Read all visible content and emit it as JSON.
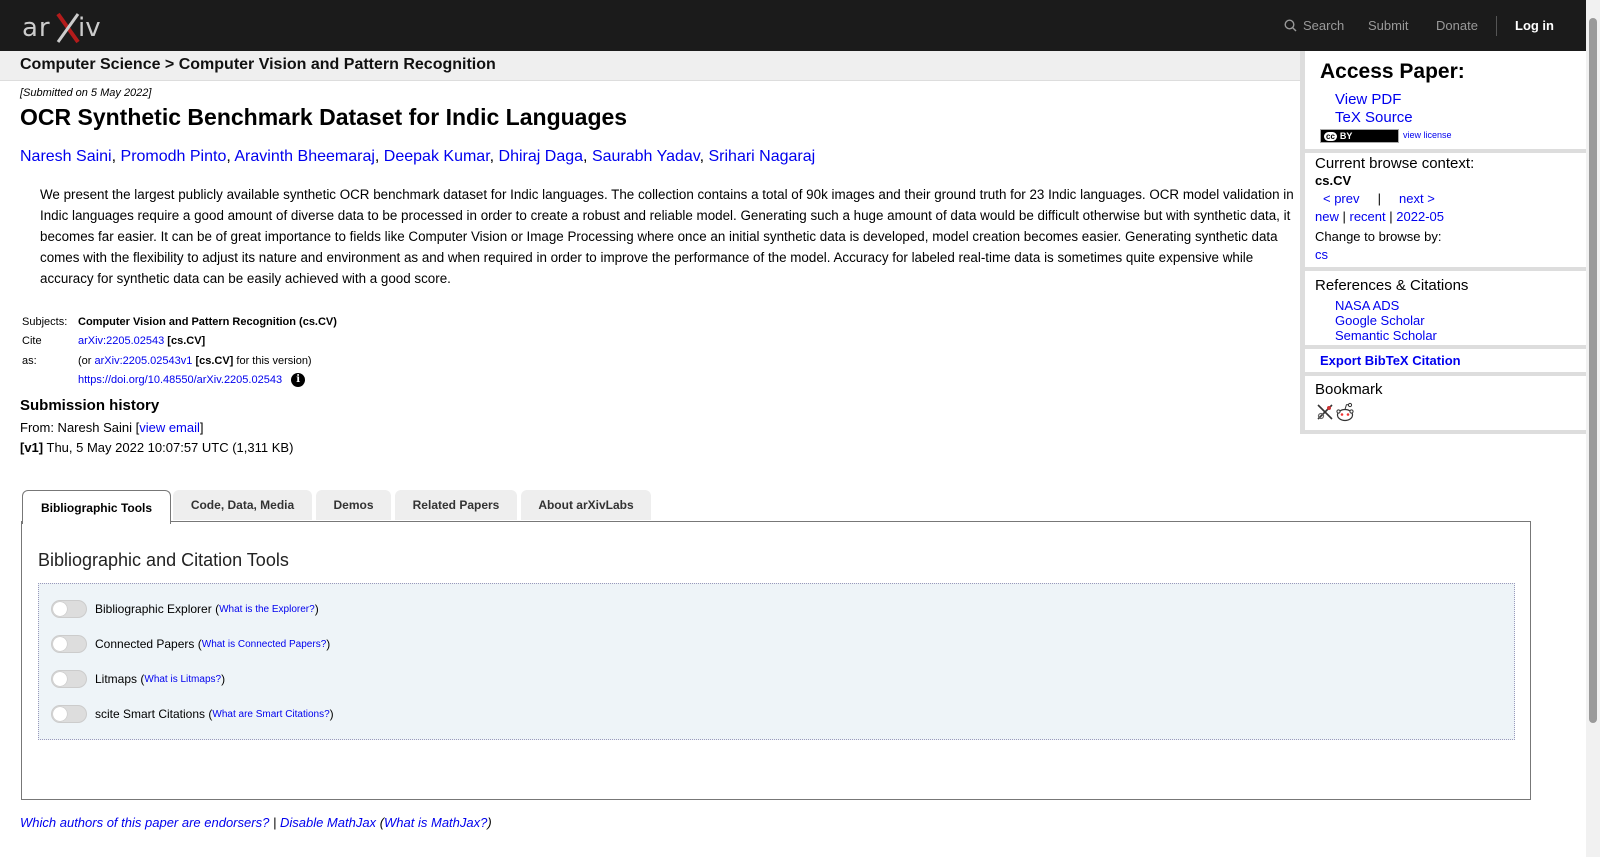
{
  "header": {
    "logo_text": "arXiv",
    "nav": {
      "search": "Search",
      "submit": "Submit",
      "donate": "Donate",
      "login": "Log in"
    }
  },
  "breadcrumb": "Computer Science > Computer Vision and Pattern Recognition",
  "paper": {
    "submitted": "[Submitted on 5 May 2022]",
    "title": "OCR Synthetic Benchmark Dataset for Indic Languages",
    "authors": [
      "Naresh Saini",
      "Promodh Pinto",
      "Aravinth Bheemaraj",
      "Deepak Kumar",
      "Dhiraj Daga",
      "Saurabh Yadav",
      "Srihari Nagaraj"
    ],
    "author_separator": ",",
    "abstract": "We present the largest publicly available synthetic OCR benchmark dataset for Indic languages. The collection contains a total of 90k images and their ground truth for 23 Indic languages. OCR model validation in Indic languages require a good amount of diverse data to be processed in order to create a robust and reliable model. Generating such a huge amount of data would be difficult otherwise but with synthetic data, it becomes far easier. It can be of great importance to fields like Computer Vision or Image Processing where once an initial synthetic data is developed, model creation becomes easier. Generating synthetic data comes with the flexibility to adjust its nature and environment as and when required in order to improve the performance of the model. Accuracy for labeled real-time data is sometimes quite expensive while accuracy for synthetic data can be easily achieved with a good score.",
    "subjects_label": "Subjects:",
    "subjects_value": "Computer Vision and Pattern Recognition (cs.CV)",
    "cite_label": "Cite as:",
    "cite_id": "arXiv:2205.02543",
    "cite_cat": "[cs.CV]",
    "cite_or_prefix": "(or",
    "cite_version_id": "arXiv:2205.02543v1",
    "cite_version_cat": "[cs.CV]",
    "cite_version_suffix": "for this version)",
    "doi": "https://doi.org/10.48550/arXiv.2205.02543",
    "info_glyph": "i"
  },
  "history": {
    "title": "Submission history",
    "from_prefix": "From: Naresh Saini [",
    "view_email": "view email",
    "from_suffix": "]",
    "version_tag": "[v1]",
    "version_text": "Thu, 5 May 2022 10:07:57 UTC (1,311 KB)"
  },
  "tabs": [
    "Bibliographic Tools",
    "Code, Data, Media",
    "Demos",
    "Related Papers",
    "About arXivLabs"
  ],
  "panel": {
    "title": "Bibliographic and Citation Tools",
    "tools": [
      {
        "label": "Bibliographic Explorer",
        "link": "What is the Explorer?"
      },
      {
        "label": "Connected Papers",
        "link": "What is Connected Papers?"
      },
      {
        "label": "Litmaps",
        "link": "What is Litmaps?"
      },
      {
        "label": "scite Smart Citations",
        "link": "What are Smart Citations?"
      }
    ]
  },
  "footer": {
    "endorsers": "Which authors of this paper are endorsers?",
    "pipe": "|",
    "disable_mathjax": "Disable MathJax",
    "what_mathjax": "What is MathJax?",
    "open_paren": "(",
    "close_paren": ")"
  },
  "sidebar": {
    "access_title": "Access Paper:",
    "view_pdf": "View PDF",
    "tex_source": "TeX Source",
    "license_badge_cc": "cc",
    "license_badge_by": "BY",
    "view_license": "view license",
    "context_title": "Current browse context:",
    "context_value": "cs.CV",
    "prev": "< prev",
    "nav_pipe": "|",
    "next": "next >",
    "new": "new",
    "recent": "recent",
    "month": "2022-05",
    "change_browse": "Change to browse by:",
    "browse_cs": "cs",
    "refs_title": "References & Citations",
    "refs": [
      "NASA ADS",
      "Google Scholar",
      "Semantic Scholar"
    ],
    "export_bibtex": "Export BibTeX Citation",
    "bookmark_title": "Bookmark"
  },
  "colors": {
    "header_bg": "#1b1b1b",
    "link": "#0000ee",
    "logo_x": "#b31b1b"
  },
  "icons": [
    "search-icon",
    "info-icon",
    "bibsonomy-icon",
    "reddit-icon"
  ]
}
